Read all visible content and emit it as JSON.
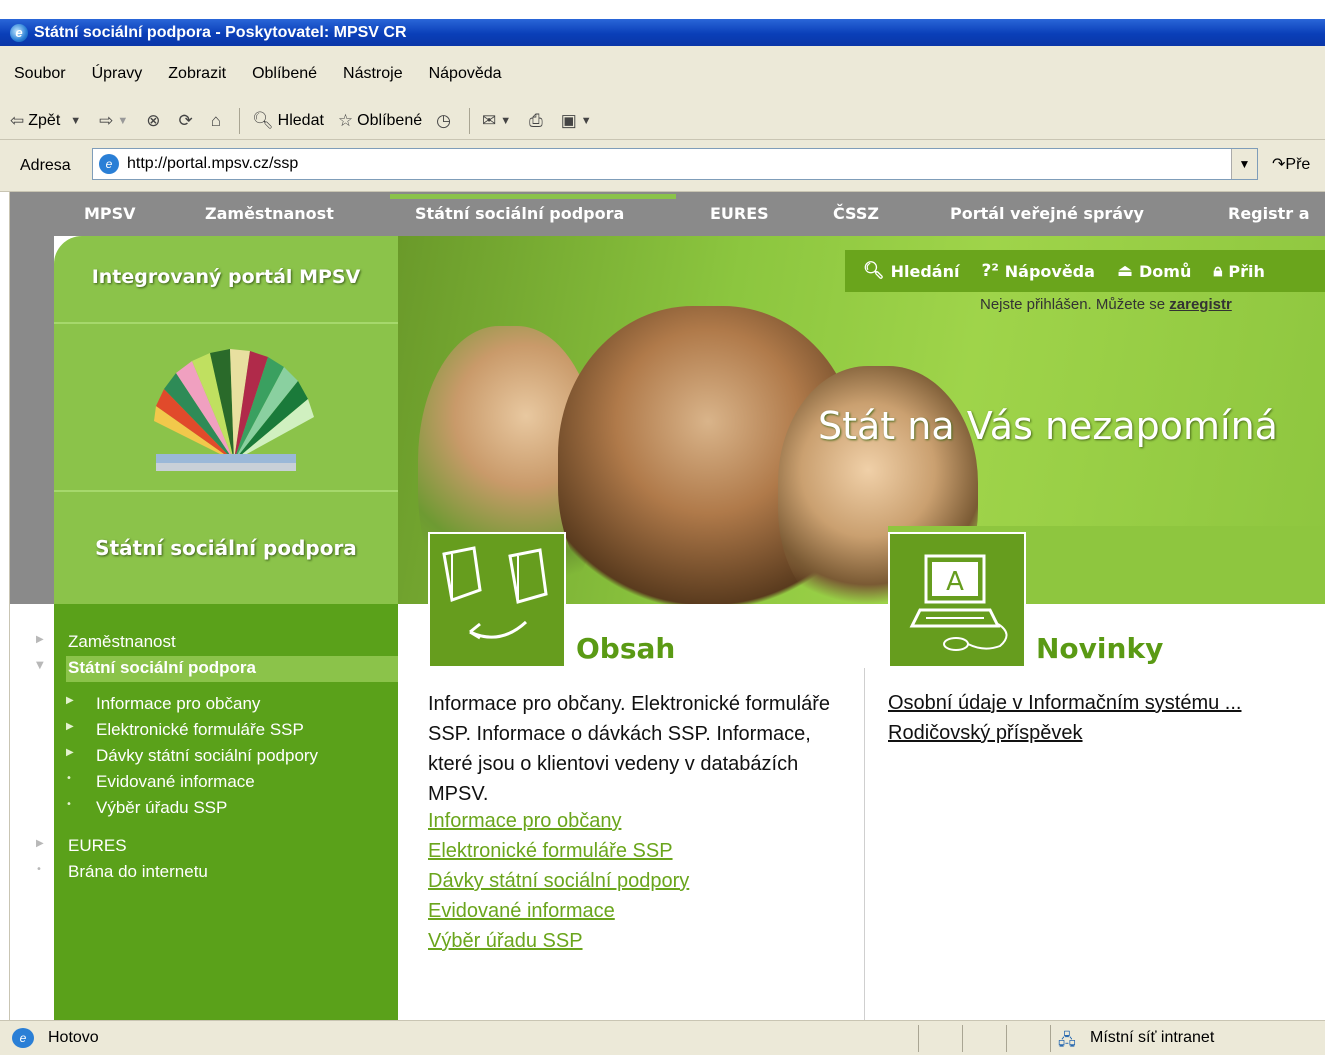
{
  "window": {
    "title": "Státní sociální podpora - Poskytovatel: MPSV CR"
  },
  "menu": [
    "Soubor",
    "Úpravy",
    "Zobrazit",
    "Oblíbené",
    "Nástroje",
    "Nápověda"
  ],
  "toolbar": {
    "back": "Zpět",
    "search": "Hledat",
    "favorites": "Oblíbené"
  },
  "address": {
    "label": "Adresa",
    "url": "http://portal.mpsv.cz/ssp",
    "go": "Pře"
  },
  "topnav": [
    "MPSV",
    "Zaměstnanost",
    "Státní sociální podpora",
    "EURES",
    "ČSSZ",
    "Portál veřejné správy",
    "Registr a"
  ],
  "header": {
    "portal_title": "Integrovaný portál MPSV",
    "section_title": "Státní sociální podpora",
    "slogan": "Stát na Vás nezapomíná",
    "tools": {
      "search": "Hledání",
      "help": "Nápověda",
      "home": "Domů",
      "login": "Přih"
    },
    "login_text": "Nejste přihlášen. Můžete se",
    "register_link": "zaregistr"
  },
  "leftnav": {
    "items": [
      {
        "label": "Zaměstnanost"
      },
      {
        "label": "Státní sociální podpora"
      },
      {
        "label": "Informace pro občany"
      },
      {
        "label": "Elektronické formuláře SSP"
      },
      {
        "label": "Dávky státní sociální podpory"
      },
      {
        "label": "Evidované informace"
      },
      {
        "label": "Výběr úřadu SSP"
      },
      {
        "label": "EURES"
      },
      {
        "label": "Brána do internetu"
      }
    ]
  },
  "obsah": {
    "title": "Obsah",
    "description": "Informace pro občany. Elektronické formuláře SSP. Informace o dávkách SSP. Informace, které jsou o klientovi vedeny v databázích MPSV.",
    "links": [
      "Informace pro občany",
      "Elektronické formuláře SSP",
      "Dávky státní sociální podpory",
      "Evidované informace",
      "Výběr úřadu SSP"
    ]
  },
  "novinky": {
    "title": "Novinky",
    "links": [
      "Osobní údaje v Informačním systému ...",
      "Rodičovský příspěvek"
    ]
  },
  "status": {
    "text": "Hotovo",
    "zone": "Místní síť intranet"
  },
  "colors": {
    "accent_green": "#8bc34a",
    "dark_green": "#5aa11a",
    "link_green": "#6aa51c",
    "nav_grey": "#8a8a8a"
  }
}
